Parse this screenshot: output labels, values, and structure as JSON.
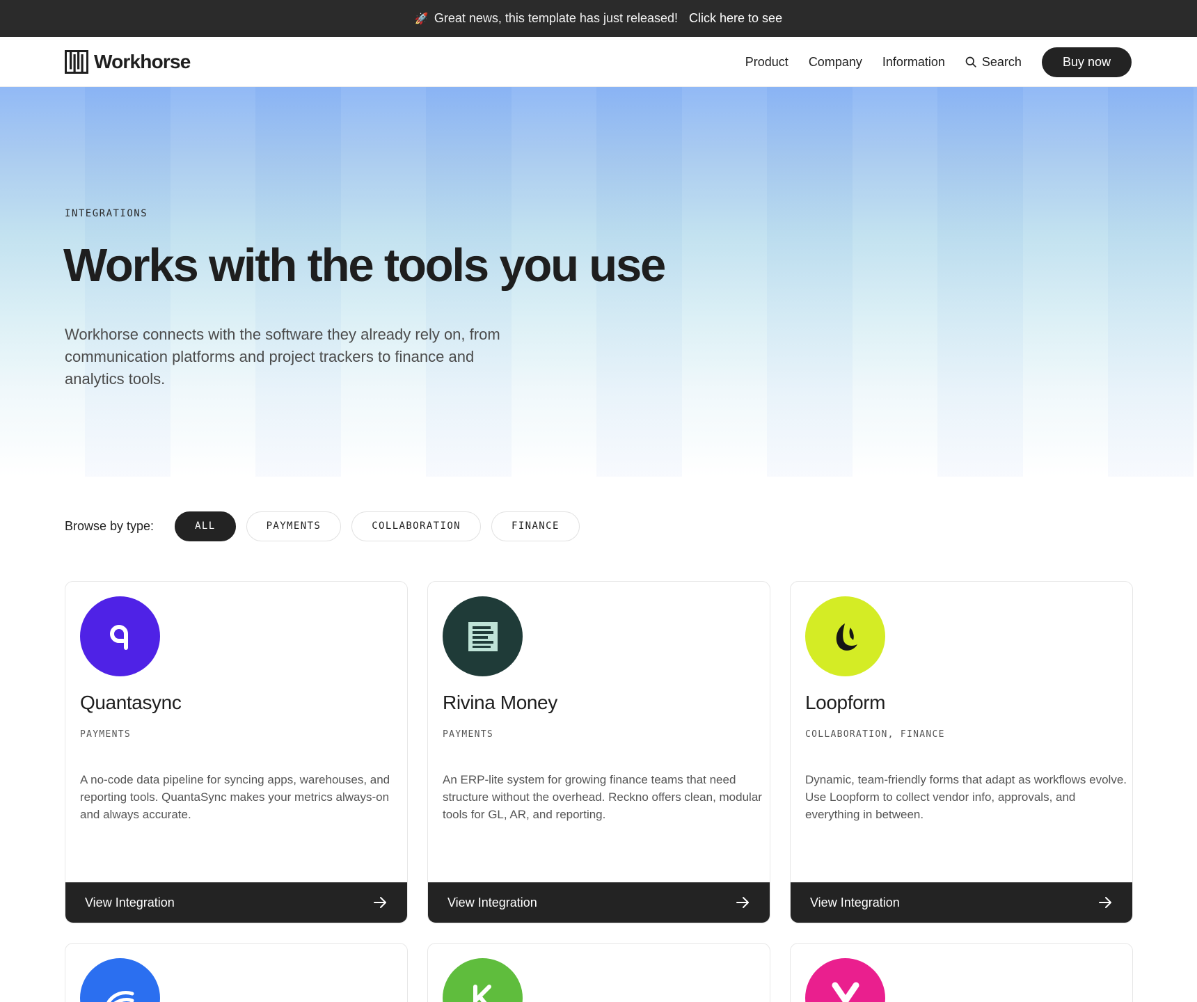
{
  "announcement": {
    "icon": "rocket-icon",
    "text": "Great news, this template has just released!",
    "link": "Click here to see"
  },
  "nav": {
    "logo_text": "Workhorse",
    "links": [
      "Product",
      "Company",
      "Information"
    ],
    "search_label": "Search",
    "cta": "Buy now"
  },
  "hero": {
    "eyebrow": "INTEGRATIONS",
    "title": "Works with the tools you use",
    "description": "Workhorse connects with the software they already rely on, from communication platforms and project trackers to finance and analytics tools."
  },
  "filters": {
    "label": "Browse by type:",
    "options": [
      "ALL",
      "PAYMENTS",
      "COLLABORATION",
      "FINANCE"
    ],
    "active": "ALL"
  },
  "cards": [
    {
      "name": "Quantasync",
      "tags": "PAYMENTS",
      "description_lines": [
        "A no-code data pipeline for syncing apps, warehouses, and",
        "reporting tools. QuantaSync makes your metrics always-on",
        "and always accurate."
      ],
      "icon_color": "#4f22e6",
      "icon": "quantasync-logo-icon",
      "cta": "View Integration"
    },
    {
      "name": "Rivina Money",
      "tags": "PAYMENTS",
      "description_lines": [
        "An ERP-lite system for growing finance teams that need",
        "structure without the overhead. Reckno offers clean, modular",
        "tools for GL, AR, and reporting."
      ],
      "icon_color": "#1f3b38",
      "icon": "rivina-money-logo-icon",
      "cta": "View Integration"
    },
    {
      "name": "Loopform",
      "tags": "COLLABORATION, FINANCE",
      "description_lines": [
        "Dynamic, team-friendly forms that adapt as workflows evolve.",
        "Use Loopform to collect vendor info, approvals, and",
        "everything in between."
      ],
      "icon_color": "#d4ec25",
      "icon": "loopform-logo-icon",
      "cta": "View Integration"
    }
  ],
  "cards_row2": [
    {
      "icon_color": "#2b6ff0",
      "icon": "wave-logo-icon"
    },
    {
      "icon_color": "#5fbd3d",
      "icon": "k-logo-icon"
    },
    {
      "icon_color": "#ea1f8e",
      "icon": "y-logo-icon"
    }
  ]
}
